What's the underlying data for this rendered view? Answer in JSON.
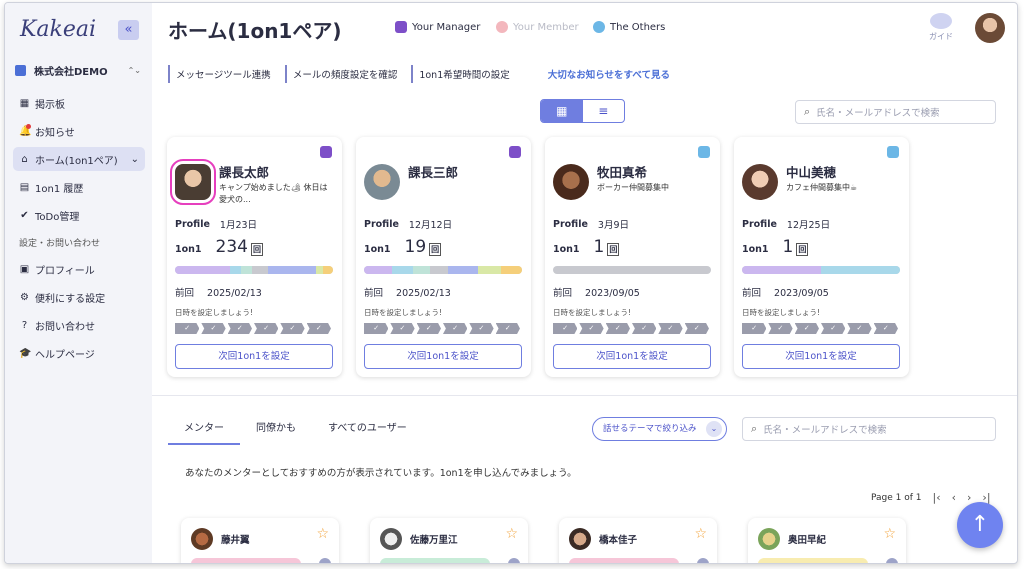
{
  "sidebar": {
    "logo": "Kakeai",
    "collapse_icon": "«",
    "company": "株式会社DEMO",
    "items": [
      {
        "label": "掲示板",
        "icon": "▦"
      },
      {
        "label": "お知らせ",
        "icon": "🔔"
      },
      {
        "label": "ホーム(1on1ペア)",
        "icon": "⌂"
      },
      {
        "label": "1on1 履歴",
        "icon": "▤"
      },
      {
        "label": "ToDo管理",
        "icon": "✔"
      }
    ],
    "section_label": "設定・お問い合わせ",
    "settings_items": [
      {
        "label": "プロフィール",
        "icon": "▣"
      },
      {
        "label": "便利にする設定",
        "icon": "⚙"
      },
      {
        "label": "お問い合わせ",
        "icon": "?"
      },
      {
        "label": "ヘルプページ",
        "icon": "🎓"
      }
    ]
  },
  "header": {
    "title": "ホーム(1on1ペア)",
    "legend": [
      {
        "label": "Your Manager",
        "color": "#7d4fc8"
      },
      {
        "label": "Your Member",
        "color": "#f3b7bd"
      },
      {
        "label": "The Others",
        "color": "#6cb7e6"
      }
    ],
    "guide_label": "ガイド"
  },
  "links": {
    "items": [
      "メッセージツール連携",
      "メールの頻度設定を確認",
      "1on1希望時間の設定"
    ],
    "all_notices": "大切なお知らせをすべて見る"
  },
  "view_toggle": {
    "grid_icon": "▦",
    "list_icon": "≡"
  },
  "search": {
    "placeholder": "氏名・メールアドレスで検索"
  },
  "cards": [
    {
      "name": "課長太郎",
      "status": "キャンプ始めました🏕 休日は愛犬の...",
      "type_color": "#7d4fc8",
      "profile_label": "Profile",
      "profile_date": "1月23日",
      "oneonone_label": "1on1",
      "count": "234",
      "unit": "回",
      "prev_label": "前回",
      "prev_date": "2025/02/13",
      "hint": "日時を設定しましょう!",
      "button": "次回1on1を設定",
      "bar": [
        {
          "w": 35,
          "c": "#cbb7ef"
        },
        {
          "w": 7,
          "c": "#a8d8ea"
        },
        {
          "w": 7,
          "c": "#bfe3d8"
        },
        {
          "w": 10,
          "c": "#c8c9cf"
        },
        {
          "w": 30,
          "c": "#aab6ee"
        },
        {
          "w": 5,
          "c": "#d9e8a6"
        },
        {
          "w": 6,
          "c": "#f5cf7a"
        }
      ],
      "avatar": "radial-gradient(circle at 50% 40%, #e9c7a8 0 30%, #4a3d33 31% 100%)",
      "selected": true
    },
    {
      "name": "課長三郎",
      "status": "",
      "type_color": "#7d4fc8",
      "profile_label": "Profile",
      "profile_date": "12月12日",
      "oneonone_label": "1on1",
      "count": "19",
      "unit": "回",
      "prev_label": "前回",
      "prev_date": "2025/02/13",
      "hint": "日時を設定しましょう!",
      "button": "次回1on1を設定",
      "bar": [
        {
          "w": 18,
          "c": "#cbb7ef"
        },
        {
          "w": 13,
          "c": "#a8d8ea"
        },
        {
          "w": 11,
          "c": "#bfe3d8"
        },
        {
          "w": 11,
          "c": "#c8c9cf"
        },
        {
          "w": 19,
          "c": "#aab6ee"
        },
        {
          "w": 15,
          "c": "#d9e8a6"
        },
        {
          "w": 13,
          "c": "#f5cf7a"
        }
      ],
      "avatar": "radial-gradient(circle at 50% 40%, #e2b98f 0 30%, #7a8a94 31% 100%)",
      "selected": false
    },
    {
      "name": "牧田真希",
      "status": "ボーカー仲間募集中",
      "type_color": "#6cb7e6",
      "profile_label": "Profile",
      "profile_date": "3月9日",
      "oneonone_label": "1on1",
      "count": "1",
      "unit": "回",
      "prev_label": "前回",
      "prev_date": "2023/09/05",
      "hint": "日時を設定しましょう!",
      "button": "次回1on1を設定",
      "bar": [
        {
          "w": 100,
          "c": "#c8c9cf"
        }
      ],
      "avatar": "radial-gradient(circle at 50% 45%, #a8704c 0 32%, #4a2a1c 33% 100%)",
      "selected": false
    },
    {
      "name": "中山美穂",
      "status": "カフェ仲間募集中☕",
      "type_color": "#6cb7e6",
      "profile_label": "Profile",
      "profile_date": "12月25日",
      "oneonone_label": "1on1",
      "count": "1",
      "unit": "回",
      "prev_label": "前回",
      "prev_date": "2023/09/05",
      "hint": "日時を設定しましょう!",
      "button": "次回1on1を設定",
      "bar": [
        {
          "w": 50,
          "c": "#cbb7ef"
        },
        {
          "w": 50,
          "c": "#a8d8ea"
        }
      ],
      "avatar": "radial-gradient(circle at 50% 42%, #f0cdb5 0 30%, #5a3a2e 31% 100%)",
      "selected": false
    }
  ],
  "lower": {
    "tabs": [
      "メンター",
      "同僚かも",
      "すべてのユーザー"
    ],
    "filter": "話せるテーマで絞り込み",
    "description": "あなたのメンターとしておすすめの方が表示されています。1on1を申し込んでみましょう。",
    "pager": {
      "label": "Page 1 of 1",
      "first": "|‹",
      "prev": "‹",
      "next": "›",
      "last": "›|"
    },
    "mentors": [
      {
        "name": "藤井翼",
        "tag": "#f6c6d8",
        "avatar": "radial-gradient(circle, #b56a43 0 40%, #5e3a24 41%)"
      },
      {
        "name": "佐藤万里江",
        "tag": "#c8ecd8",
        "avatar": "radial-gradient(circle, #eeeeee 0 40%, #555 41%)"
      },
      {
        "name": "橋本佳子",
        "tag": "#f6c6d8",
        "avatar": "radial-gradient(circle, #d6a98a 0 40%, #3a2a24 41%)"
      },
      {
        "name": "奥田早紀",
        "tag": "#f8ecb0",
        "avatar": "radial-gradient(circle, #e6d28a 0 40%, #7aa45a 41%)"
      }
    ],
    "scroll_top_icon": "↑"
  },
  "step_check": "✓"
}
